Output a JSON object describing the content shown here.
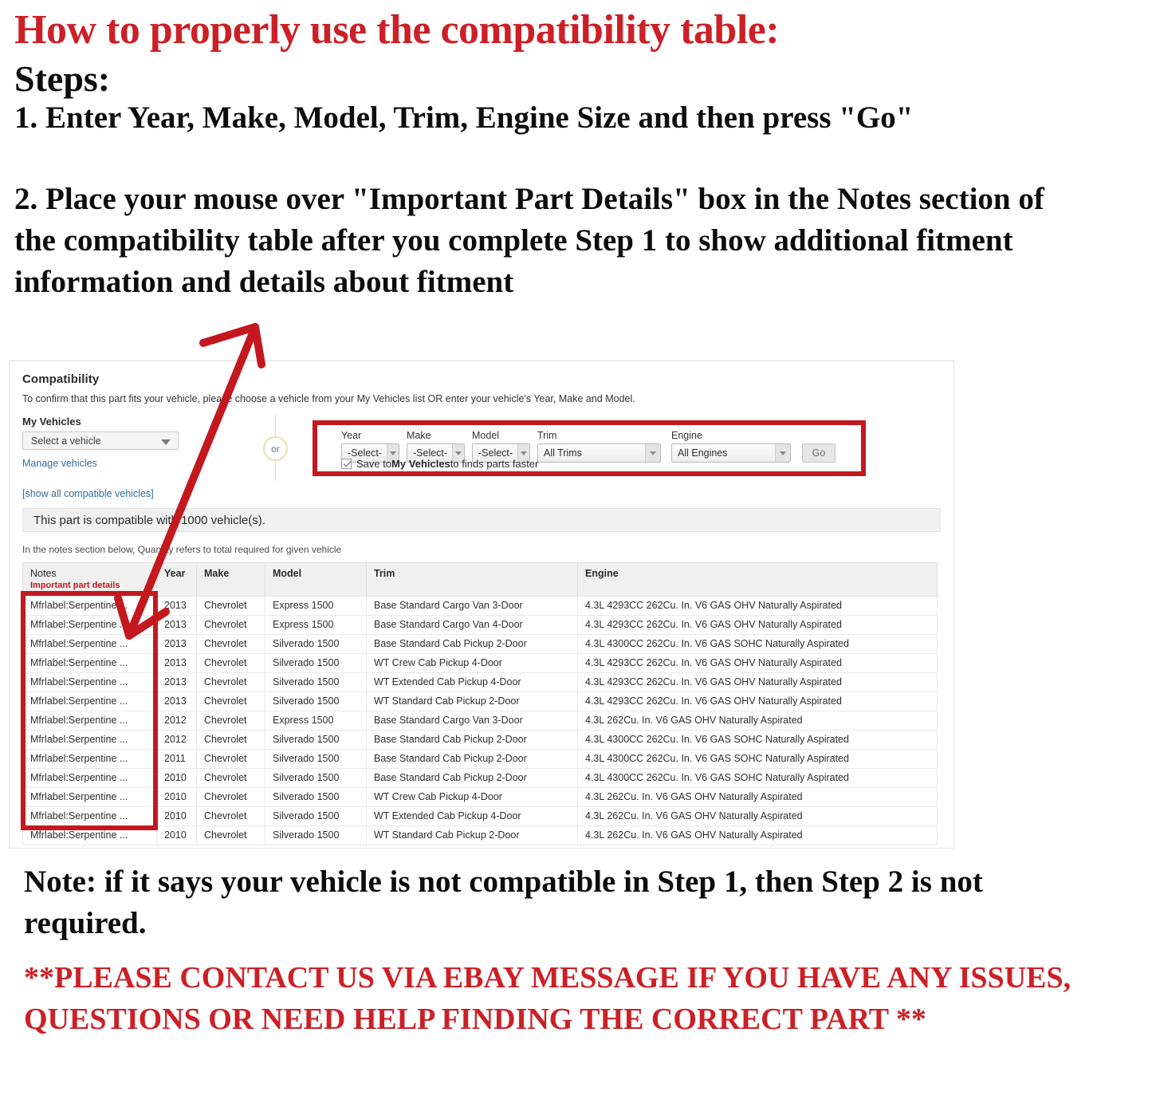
{
  "intro": {
    "headline": "How to properly use the compatibility table:",
    "steps_label": "Steps:",
    "step1": "1. Enter Year, Make, Model, Trim, Engine Size and then press \"Go\"",
    "step2": "2. Place your mouse over \"Important Part Details\" box in the Notes section of the compatibility table after you complete Step 1 to show additional fitment information and details about fitment"
  },
  "widget": {
    "title": "Compatibility",
    "subtitle": "To confirm that this part fits your vehicle, please choose a vehicle from your My Vehicles list OR enter your vehicle's Year, Make and Model.",
    "my_vehicles": {
      "label": "My Vehicles",
      "select_value": "Select a vehicle",
      "manage_link": "Manage vehicles",
      "show_all_link": "[show all compatible vehicles]"
    },
    "or_label": "or",
    "selectors": [
      {
        "caption": "Year",
        "value": "-Select-"
      },
      {
        "caption": "Make",
        "value": "-Select-"
      },
      {
        "caption": "Model",
        "value": "-Select-"
      },
      {
        "caption": "Trim",
        "value": "All Trims"
      },
      {
        "caption": "Engine",
        "value": "All Engines"
      }
    ],
    "go_label": "Go",
    "save_checkbox": {
      "checked": true,
      "text_before": "Save to ",
      "text_bold": "My Vehicles",
      "text_after": " to finds parts faster"
    },
    "compatible_banner": "This part is compatible with 1000 vehicle(s).",
    "notes_hint": "In the notes section below, Quantity refers to total required for given vehicle",
    "table": {
      "headers": {
        "notes": "Notes",
        "notes_sub": "Important part details",
        "year": "Year",
        "make": "Make",
        "model": "Model",
        "trim": "Trim",
        "engine": "Engine"
      },
      "rows": [
        {
          "notes": "Mfrlabel:Serpentine ...",
          "year": "2013",
          "make": "Chevrolet",
          "model": "Express 1500",
          "trim": "Base Standard Cargo Van 3-Door",
          "engine": "4.3L 4293CC 262Cu. In. V6 GAS OHV Naturally Aspirated"
        },
        {
          "notes": "Mfrlabel:Serpentine ...",
          "year": "2013",
          "make": "Chevrolet",
          "model": "Express 1500",
          "trim": "Base Standard Cargo Van 4-Door",
          "engine": "4.3L 4293CC 262Cu. In. V6 GAS OHV Naturally Aspirated"
        },
        {
          "notes": "Mfrlabel:Serpentine ...",
          "year": "2013",
          "make": "Chevrolet",
          "model": "Silverado 1500",
          "trim": "Base Standard Cab Pickup 2-Door",
          "engine": "4.3L 4300CC 262Cu. In. V6 GAS SOHC Naturally Aspirated"
        },
        {
          "notes": "Mfrlabel:Serpentine ...",
          "year": "2013",
          "make": "Chevrolet",
          "model": "Silverado 1500",
          "trim": "WT Crew Cab Pickup 4-Door",
          "engine": "4.3L 4293CC 262Cu. In. V6 GAS OHV Naturally Aspirated"
        },
        {
          "notes": "Mfrlabel:Serpentine ...",
          "year": "2013",
          "make": "Chevrolet",
          "model": "Silverado 1500",
          "trim": "WT Extended Cab Pickup 4-Door",
          "engine": "4.3L 4293CC 262Cu. In. V6 GAS OHV Naturally Aspirated"
        },
        {
          "notes": "Mfrlabel:Serpentine ...",
          "year": "2013",
          "make": "Chevrolet",
          "model": "Silverado 1500",
          "trim": "WT Standard Cab Pickup 2-Door",
          "engine": "4.3L 4293CC 262Cu. In. V6 GAS OHV Naturally Aspirated"
        },
        {
          "notes": "Mfrlabel:Serpentine ...",
          "year": "2012",
          "make": "Chevrolet",
          "model": "Express 1500",
          "trim": "Base Standard Cargo Van 3-Door",
          "engine": "4.3L 262Cu. In. V6 GAS OHV Naturally Aspirated"
        },
        {
          "notes": "Mfrlabel:Serpentine ...",
          "year": "2012",
          "make": "Chevrolet",
          "model": "Silverado 1500",
          "trim": "Base Standard Cab Pickup 2-Door",
          "engine": "4.3L 4300CC 262Cu. In. V6 GAS SOHC Naturally Aspirated"
        },
        {
          "notes": "Mfrlabel:Serpentine ...",
          "year": "2011",
          "make": "Chevrolet",
          "model": "Silverado 1500",
          "trim": "Base Standard Cab Pickup 2-Door",
          "engine": "4.3L 4300CC 262Cu. In. V6 GAS SOHC Naturally Aspirated"
        },
        {
          "notes": "Mfrlabel:Serpentine ...",
          "year": "2010",
          "make": "Chevrolet",
          "model": "Silverado 1500",
          "trim": "Base Standard Cab Pickup 2-Door",
          "engine": "4.3L 4300CC 262Cu. In. V6 GAS SOHC Naturally Aspirated"
        },
        {
          "notes": "Mfrlabel:Serpentine ...",
          "year": "2010",
          "make": "Chevrolet",
          "model": "Silverado 1500",
          "trim": "WT Crew Cab Pickup 4-Door",
          "engine": "4.3L 262Cu. In. V6 GAS OHV Naturally Aspirated"
        },
        {
          "notes": "Mfrlabel:Serpentine ...",
          "year": "2010",
          "make": "Chevrolet",
          "model": "Silverado 1500",
          "trim": "WT Extended Cab Pickup 4-Door",
          "engine": "4.3L 262Cu. In. V6 GAS OHV Naturally Aspirated"
        },
        {
          "notes": "Mfrlabel:Serpentine ...",
          "year": "2010",
          "make": "Chevrolet",
          "model": "Silverado 1500",
          "trim": "WT Standard Cab Pickup 2-Door",
          "engine": "4.3L 262Cu. In. V6 GAS OHV Naturally Aspirated"
        }
      ]
    }
  },
  "footer": {
    "note": "Note: if it says your vehicle is not compatible in Step 1, then Step 2 is not required.",
    "contact": "**PLEASE CONTACT US VIA EBAY MESSAGE IF YOU HAVE ANY ISSUES, QUESTIONS OR NEED HELP FINDING THE CORRECT PART **"
  },
  "colors": {
    "headline_red": "#CC2026",
    "annotation_red": "#C4181F",
    "link_blue": "#2e6e9e"
  }
}
